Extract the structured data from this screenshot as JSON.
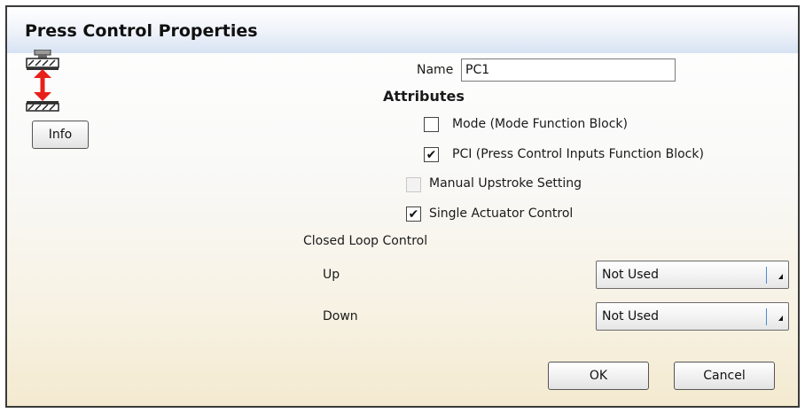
{
  "window": {
    "title": "Press Control Properties"
  },
  "info_button": {
    "label": "Info"
  },
  "icon": {
    "name": "press-control-icon",
    "accent": "#e8201a"
  },
  "name_field": {
    "label": "Name",
    "value": "PC1"
  },
  "attributes": {
    "heading": "Attributes",
    "items": [
      {
        "label": "Mode (Mode Function Block)",
        "checked": false,
        "enabled": true
      },
      {
        "label": "PCI (Press Control Inputs Function Block)",
        "checked": true,
        "enabled": true
      },
      {
        "label": "Manual Upstroke Setting",
        "checked": false,
        "enabled": false
      },
      {
        "label": "Single Actuator Control",
        "checked": true,
        "enabled": true
      }
    ]
  },
  "closed_loop": {
    "heading": "Closed Loop Control",
    "up": {
      "label": "Up",
      "selected": "Not Used"
    },
    "down": {
      "label": "Down",
      "selected": "Not Used"
    }
  },
  "buttons": {
    "ok": "OK",
    "cancel": "Cancel"
  },
  "check_glyph": "✔"
}
